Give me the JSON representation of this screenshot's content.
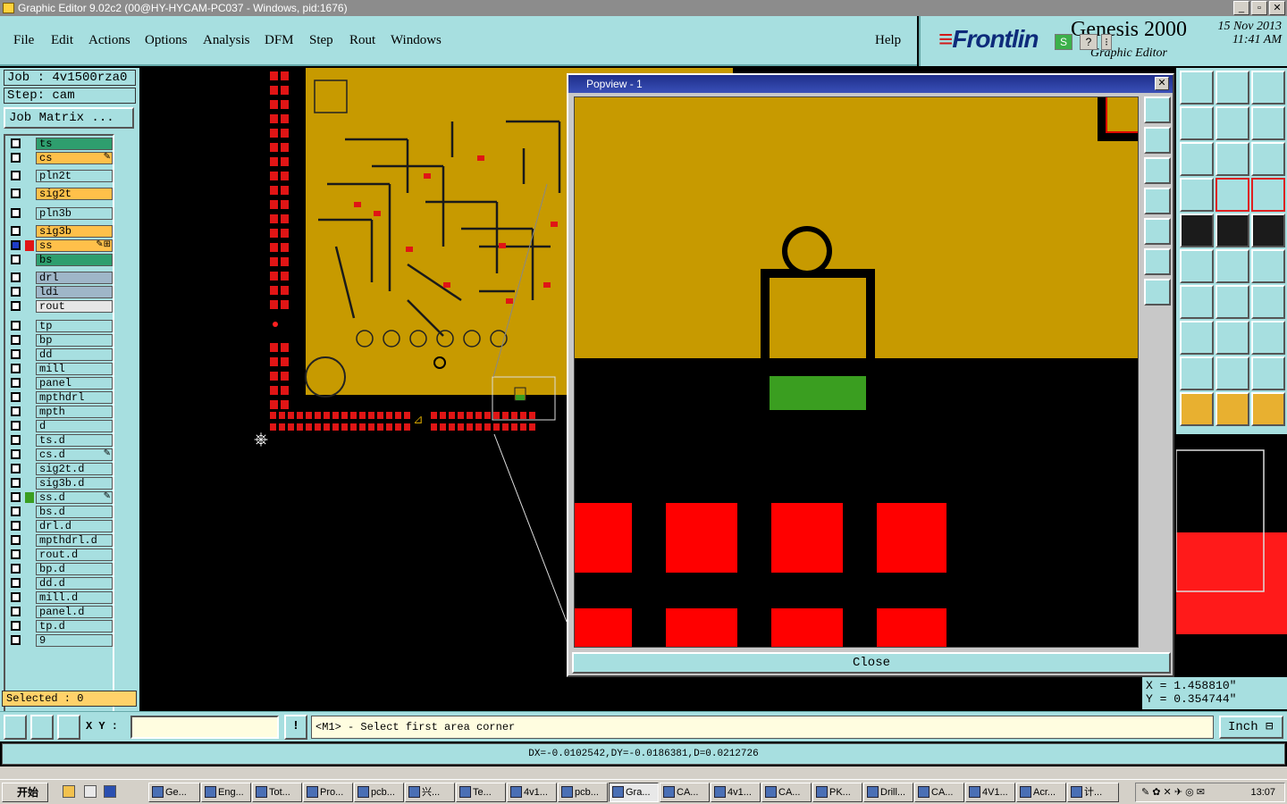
{
  "window": {
    "title": "Graphic Editor 9.02c2 (00@HY-HYCAM-PC037 - Windows, pid:1676)",
    "min": "_",
    "max": "▫",
    "close": "✕"
  },
  "menu": [
    "File",
    "Edit",
    "Actions",
    "Options",
    "Analysis",
    "DFM",
    "Step",
    "Rout",
    "Windows"
  ],
  "help": "Help",
  "brand": {
    "logo": "Frontlin",
    "product": "Genesis 2000",
    "subtitle": "Graphic Editor",
    "date": "15 Nov 2013",
    "time": "11:41 AM",
    "mini_s": "S",
    "mini_q": "?"
  },
  "job": {
    "job_label": "Job : 4v1500rza0",
    "step_label": "Step: cam",
    "matrix_button": "Job Matrix ..."
  },
  "layers": [
    {
      "name": "ts",
      "color": "#2e9e6e",
      "mark": ""
    },
    {
      "name": "cs",
      "color": "#ffc04a",
      "mark": "✎"
    },
    {
      "name": "pln2t",
      "color": "#a7dfe0",
      "mark": ""
    },
    {
      "name": "sig2t",
      "color": "#ffc04a",
      "mark": ""
    },
    {
      "name": "pln3b",
      "color": "#a7dfe0",
      "mark": ""
    },
    {
      "name": "sig3b",
      "color": "#ffc04a",
      "mark": ""
    },
    {
      "name": "ss",
      "color": "#ffc04a",
      "mark": "✎⊞"
    },
    {
      "name": "bs",
      "color": "#2e9e6e",
      "mark": ""
    },
    {
      "name": "drl",
      "color": "#9fb6c8",
      "mark": ""
    },
    {
      "name": "ldi",
      "color": "#9fb6c8",
      "mark": ""
    },
    {
      "name": "rout",
      "color": "#e6e6e6",
      "mark": ""
    },
    {
      "name": "tp",
      "color": "#a7dfe0",
      "mark": ""
    },
    {
      "name": "bp",
      "color": "#a7dfe0",
      "mark": ""
    },
    {
      "name": "dd",
      "color": "#a7dfe0",
      "mark": ""
    },
    {
      "name": "mill",
      "color": "#a7dfe0",
      "mark": ""
    },
    {
      "name": "panel",
      "color": "#a7dfe0",
      "mark": ""
    },
    {
      "name": "mpthdrl",
      "color": "#a7dfe0",
      "mark": ""
    },
    {
      "name": "mpth",
      "color": "#a7dfe0",
      "mark": ""
    },
    {
      "name": "d",
      "color": "#a7dfe0",
      "mark": ""
    },
    {
      "name": "ts.d",
      "color": "#a7dfe0",
      "mark": ""
    },
    {
      "name": "cs.d",
      "color": "#a7dfe0",
      "mark": "✎"
    },
    {
      "name": "sig2t.d",
      "color": "#a7dfe0",
      "mark": ""
    },
    {
      "name": "sig3b.d",
      "color": "#a7dfe0",
      "mark": ""
    },
    {
      "name": "ss.d",
      "color": "#a7dfe0",
      "mark": "✎"
    },
    {
      "name": "bs.d",
      "color": "#a7dfe0",
      "mark": ""
    },
    {
      "name": "drl.d",
      "color": "#a7dfe0",
      "mark": ""
    },
    {
      "name": "mpthdrl.d",
      "color": "#a7dfe0",
      "mark": ""
    },
    {
      "name": "rout.d",
      "color": "#a7dfe0",
      "mark": ""
    },
    {
      "name": "bp.d",
      "color": "#a7dfe0",
      "mark": ""
    },
    {
      "name": "dd.d",
      "color": "#a7dfe0",
      "mark": ""
    },
    {
      "name": "mill.d",
      "color": "#a7dfe0",
      "mark": ""
    },
    {
      "name": "panel.d",
      "color": "#a7dfe0",
      "mark": ""
    },
    {
      "name": "tp.d",
      "color": "#a7dfe0",
      "mark": ""
    },
    {
      "name": "9",
      "color": "#a7dfe0",
      "mark": ""
    }
  ],
  "selected": "Selected : 0",
  "popview": {
    "title": "Popview - 1",
    "close_label": "Close",
    "close_x": "✕"
  },
  "coords": {
    "x": "X = 1.458810\"",
    "y": "Y = 0.354744\""
  },
  "bottom": {
    "xy_label": "X Y :",
    "xy_value": "",
    "info": "!",
    "prompt": "<M1> - Select first area corner",
    "unit": "Inch"
  },
  "status": "DX=-0.0102542,DY=-0.0186381,D=0.0212726",
  "taskbar": {
    "start": "开始",
    "tasks": [
      "Ge...",
      "Eng...",
      "Tot...",
      "Pro...",
      "pcb...",
      "兴...",
      "Te...",
      "4v1...",
      "pcb...",
      "Gra...",
      "CA...",
      "4v1...",
      "CA...",
      "PK...",
      "Drill...",
      "CA...",
      "4V1...",
      "Acr...",
      "计..."
    ],
    "active_index": 9,
    "clock": "13:07"
  }
}
